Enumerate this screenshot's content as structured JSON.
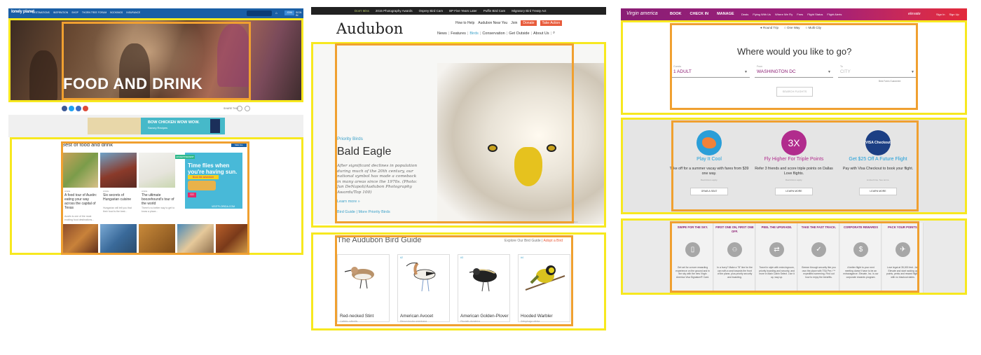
{
  "lonely_planet": {
    "logo": "lonely planet",
    "nav": [
      "DESTINATIONS",
      "INSPIRATION",
      "SHOP",
      "THORN TREE FORUM",
      "BOOKINGS",
      "INSURANCE"
    ],
    "join": "JOIN",
    "signin": "SIGN IN",
    "hero_title": "FOOD AND DRINK",
    "share_label": "SHARE THIS",
    "ad_text": "BOW CHICKEN WOW WOW.",
    "ad_sub": "Savory Recipes",
    "section_title": "Best of food and drink",
    "section_button": "SEE ALL",
    "cards": [
      {
        "cat": "Article",
        "title": "A food tour of Austin: eating your way across the capital of Texas",
        "sub": "Austin is one of the most exciting food destinations..."
      },
      {
        "cat": "Article",
        "title": "Six secrets of Hungarian cuisine",
        "sub": "Hungarian will tell you that their food is the best..."
      },
      {
        "cat": "Article",
        "title": "The ultimate boozehound's tour of the world",
        "sub": "There's no better way to get to know a place..."
      }
    ],
    "ad2_badge": "ADVERTISEMENT",
    "ad2_title": "Time flies when you're having sun.",
    "ad2_tag": "Book the adventure",
    "ad2_go": "GO",
    "ad2_url": "VISITFLORIDA.COM"
  },
  "audubon": {
    "top_links": [
      "Don't Miss",
      "2015 Photography Awards",
      "Osprey Bird Cam",
      "BP Five Years Later",
      "Puffin Bird Cam",
      "Migratory Bird Treaty Act"
    ],
    "logo": "Audubon",
    "util_links": [
      "How to Help",
      "Audubon Near You",
      "Join"
    ],
    "donate": "Donate",
    "take_action": "Take Action",
    "nav": [
      "News",
      "Features",
      "Birds",
      "Conservation",
      "Get Outside",
      "About Us"
    ],
    "priority_label": "Priority Birds",
    "bird_title": "Bald Eagle",
    "description": "After significant declines in population during much of the 20th century, our national symbol has made a comeback in many areas since the 1970s. (Photo: Jun DeNapoli/Audubon Photography Awards/Top 100)",
    "learn_more": "Learn more »",
    "guide_links": "Bird Guide  |  More Priority Birds",
    "photo_credit": "Photo: Jun DeNapoli/Audubon",
    "guide_title": "The Audubon Bird Guide",
    "explore": "Explore Our Bird Guide",
    "adopt": "Adopt a Bird",
    "birds": [
      {
        "num": "#1",
        "name": "Red-necked Stint",
        "latin": "Calidris ruficollis"
      },
      {
        "num": "#2",
        "name": "American Avocet",
        "latin": "Recurvirostra americana"
      },
      {
        "num": "#3",
        "name": "American Golden-Plover",
        "latin": "Pluvialis dominica"
      },
      {
        "num": "#4",
        "name": "Hooded Warbler",
        "latin": "Setophaga citrina"
      }
    ]
  },
  "virgin": {
    "logo": "Virgin america",
    "main_nav": [
      "BOOK",
      "CHECK IN",
      "MANAGE"
    ],
    "sub_nav": [
      "Deals",
      "Flying With Us",
      "Where We Fly",
      "Fees",
      "Flight Status",
      "Flight Alerts"
    ],
    "elevate": "elevate",
    "sign_in": "Sign In",
    "sign_up": "Sign Up",
    "trip_types": [
      "Round Trip",
      "One Way",
      "Multi City"
    ],
    "question": "Where would you like to go?",
    "guests_label": "Guests",
    "guests_value": "1 ADULT",
    "from_label": "From",
    "from_value": "WASHINGTON DC",
    "to_label": "To",
    "to_value": "CITY",
    "best_fares": "Best Fares Guarantee",
    "search_button": "SEARCH FLIGHTS",
    "promos": [
      {
        "title": "Play It Cool",
        "desc": "Take off for a summer vacay with fares from $39 one way.",
        "fine": "Restrictions apply.",
        "button": "GRAB A SEAT",
        "color": "#1e9ed8"
      },
      {
        "title": "Fly Higher For Triple Points",
        "desc": "Refer 3 friends and score triple points on Dallas Love flights.",
        "fine": "Restrictions apply.",
        "button": "LEARN MORE",
        "color": "#b12c8d"
      },
      {
        "title": "Get $25 Off A Future Flight",
        "desc": "Pay with Visa Checkout to book your flight.",
        "fine": "Limited time. See terms.",
        "button": "LEARN MORE",
        "color": "#1e9ed8"
      }
    ],
    "icon_3x": "3X",
    "icon_visa": "VISA Checkout",
    "features": [
      {
        "title": "SWIPE FOR THE SKY.",
        "icon": "phone-icon",
        "glyph": "▯",
        "desc": "Get set for a more rewarding experience on the ground and in the sky with the new Virgin America Visa Signature® Card."
      },
      {
        "title": "FIRST ONE ON, FIRST ONE OFF.",
        "icon": "people-icon",
        "glyph": "👥",
        "desc": "In a hurry? Make a \"B\" line for the can with a seat towards the front of the plane, plus priority security and boarding."
      },
      {
        "title": "PEEL THE UPGRADE.",
        "icon": "upgrade-icon",
        "glyph": "⇄",
        "desc": "Travel in style with extra legroom, priority boarding and security, and more in Main Cabin Select. Live it up, way up."
      },
      {
        "title": "TAKE THE FAST TRACK.",
        "icon": "check-icon",
        "glyph": "✓",
        "desc": "Breeze through security like you own the place with TSA Pre✓™ expedited screening. Find out how to enjoy the benefits."
      },
      {
        "title": "CORPORATE REWARDS",
        "icon": "dollar-icon",
        "glyph": "$",
        "desc": "A better flight to your next meeting doesn't have to be an extravagance. Elevate, Inc. is our corporate rewards program."
      },
      {
        "title": "PACK YOUR POINTS.",
        "icon": "plane-icon",
        "glyph": "✈",
        "desc": "Love legal at 35,000 feet. Join Elevate and start racking up points, perks and reward flights with no blackout dates."
      }
    ]
  }
}
